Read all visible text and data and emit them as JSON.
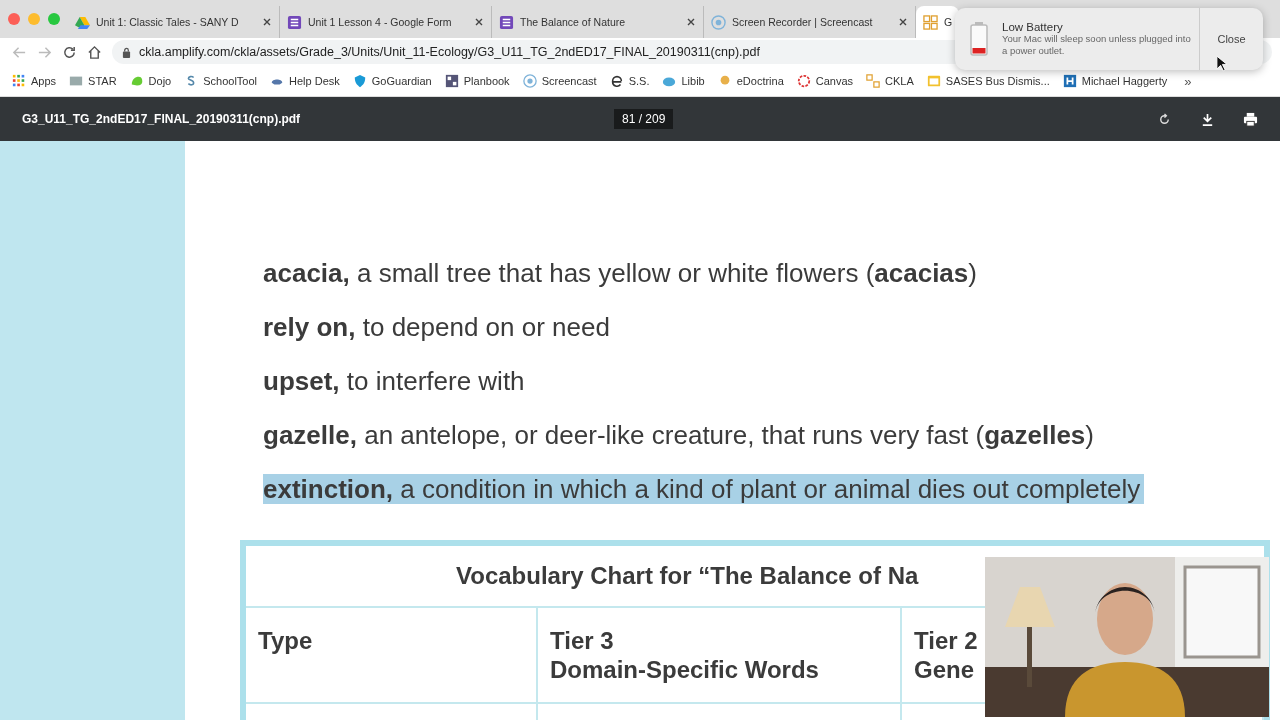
{
  "browser": {
    "tabs": [
      {
        "label": "Unit 1: Classic Tales - SANY D",
        "selected": false
      },
      {
        "label": "Unit 1 Lesson 4 - Google Form",
        "selected": false
      },
      {
        "label": "The Balance of Nature",
        "selected": false
      },
      {
        "label": "Screen Recorder | Screencast",
        "selected": false
      },
      {
        "label": "G",
        "selected": true
      }
    ],
    "address": "ckla.amplify.com/ckla/assets/Grade_3/Units/Unit_11-Ecology/G3_U11_TG_2ndED17_FINAL_20190311(cnp).pdf",
    "bookmarks": [
      {
        "label": "Apps"
      },
      {
        "label": "STAR"
      },
      {
        "label": "Dojo"
      },
      {
        "label": "SchoolTool"
      },
      {
        "label": "Help Desk"
      },
      {
        "label": "GoGuardian"
      },
      {
        "label": "Planbook"
      },
      {
        "label": "Screencast"
      },
      {
        "label": "S.S."
      },
      {
        "label": "Libib"
      },
      {
        "label": "eDoctrina"
      },
      {
        "label": "Canvas"
      },
      {
        "label": "CKLA"
      },
      {
        "label": "SASES Bus Dismis..."
      },
      {
        "label": "Michael Haggerty"
      }
    ],
    "bookmarks_more": "»"
  },
  "notification": {
    "title": "Low Battery",
    "body": "Your Mac will sleep soon unless plugged into a power outlet.",
    "action": "Close"
  },
  "pdf": {
    "filename": "G3_U11_TG_2ndED17_FINAL_20190311(cnp).pdf",
    "page": "81 / 209"
  },
  "glossary": [
    {
      "term": "acacia,",
      "definition": "a small tree that has yellow or white flowers (**acacias**)",
      "highlighted": false
    },
    {
      "term": "rely on,",
      "definition": "to depend on or need",
      "highlighted": false
    },
    {
      "term": "upset,",
      "definition": "to interfere with",
      "highlighted": false
    },
    {
      "term": "gazelle,",
      "definition": "an antelope, or deer-like creature, that runs very fast (**gazelles**)",
      "highlighted": false
    },
    {
      "term": "extinction,",
      "definition": "a condition in which a kind of plant or animal dies out completely",
      "highlighted": true
    }
  ],
  "vocab_table": {
    "title": "Vocabulary Chart for “The Balance of Na",
    "columns": [
      {
        "lines": [
          "Type"
        ]
      },
      {
        "lines": [
          "Tier 3",
          "Domain-Specific Words"
        ]
      },
      {
        "lines": [
          "Tier 2",
          "Gene"
        ]
      }
    ]
  }
}
